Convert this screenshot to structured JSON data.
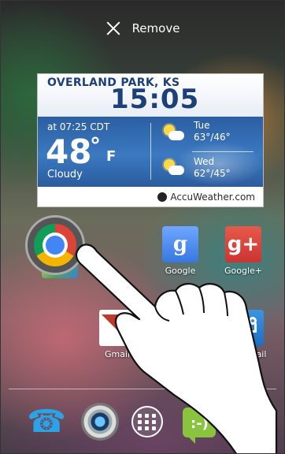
{
  "remove_bar": {
    "label": "Remove"
  },
  "weather_widget": {
    "city": "OVERLAND PARK, KS",
    "time": "15:05",
    "observed_at": "at 07:25 CDT",
    "temperature": "48",
    "degree_symbol": "°",
    "unit": "F",
    "condition": "Cloudy",
    "forecast": [
      {
        "day": "Tue",
        "high_low": "63°/46°",
        "icon": "partly-cloudy-icon"
      },
      {
        "day": "Wed",
        "high_low": "62°/45°",
        "icon": "partly-cloudy-icon"
      }
    ],
    "provider": "AccuWeather.com"
  },
  "home_apps": [
    {
      "label": "Google",
      "icon": "google-search-icon"
    },
    {
      "label": "Google+",
      "icon": "google-plus-icon"
    },
    {
      "label": "Gmail",
      "icon": "gmail-icon"
    },
    {
      "label": "Voicemail",
      "icon": "voicemail-icon"
    }
  ],
  "dragged_icon": "chrome-icon",
  "dock": [
    {
      "name": "phone-icon"
    },
    {
      "name": "camera-icon"
    },
    {
      "name": "all-apps-icon"
    },
    {
      "name": "messaging-icon"
    }
  ],
  "colors": {
    "weather_title": "#1d3f7a",
    "weather_panel": "#2c5ea3",
    "phone_blue": "#2aa3e8",
    "messaging_green": "#8ac43f"
  }
}
